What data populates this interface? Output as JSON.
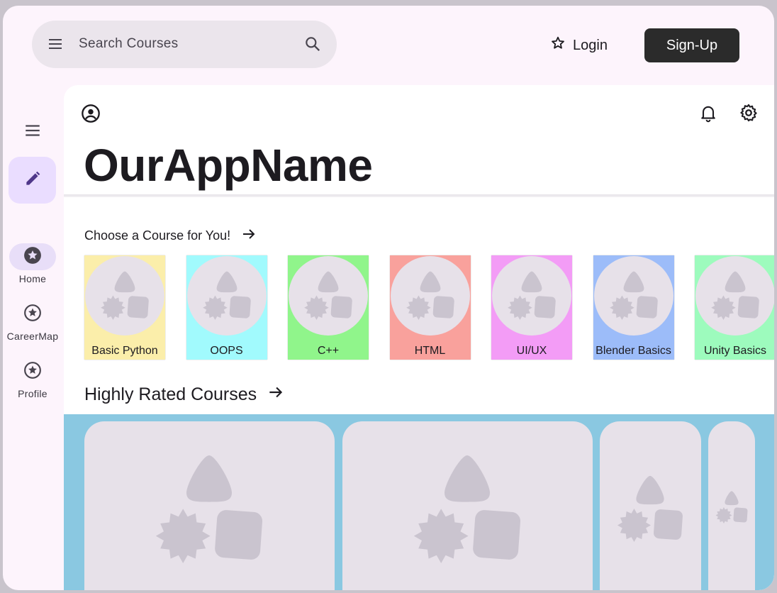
{
  "search": {
    "placeholder": "Search Courses"
  },
  "header": {
    "login_label": "Login",
    "signup_label": "Sign-Up"
  },
  "rail": {
    "items": [
      {
        "label": "Home",
        "active": true
      },
      {
        "label": "CareerMap",
        "active": false
      },
      {
        "label": "Profile",
        "active": false
      }
    ]
  },
  "main": {
    "app_name": "OurAppName",
    "section_courses": "Choose a Course for You!",
    "section_rated": "Highly Rated Courses",
    "courses": [
      {
        "label": "Basic Python",
        "color": "#fbeeaa"
      },
      {
        "label": "OOPS",
        "color": "#a1fafd"
      },
      {
        "label": "C++",
        "color": "#90f58b"
      },
      {
        "label": "HTML",
        "color": "#f9a19c"
      },
      {
        "label": "UI/UX",
        "color": "#f39cf6"
      },
      {
        "label": "Blender Basics",
        "color": "#9cbcf9"
      },
      {
        "label": "Unity Basics",
        "color": "#9dfbbd"
      }
    ]
  },
  "colors": {
    "accent_blue": "#8ac8e1",
    "fab_bg": "#eaddff",
    "signup_bg": "#2b2b2b"
  }
}
